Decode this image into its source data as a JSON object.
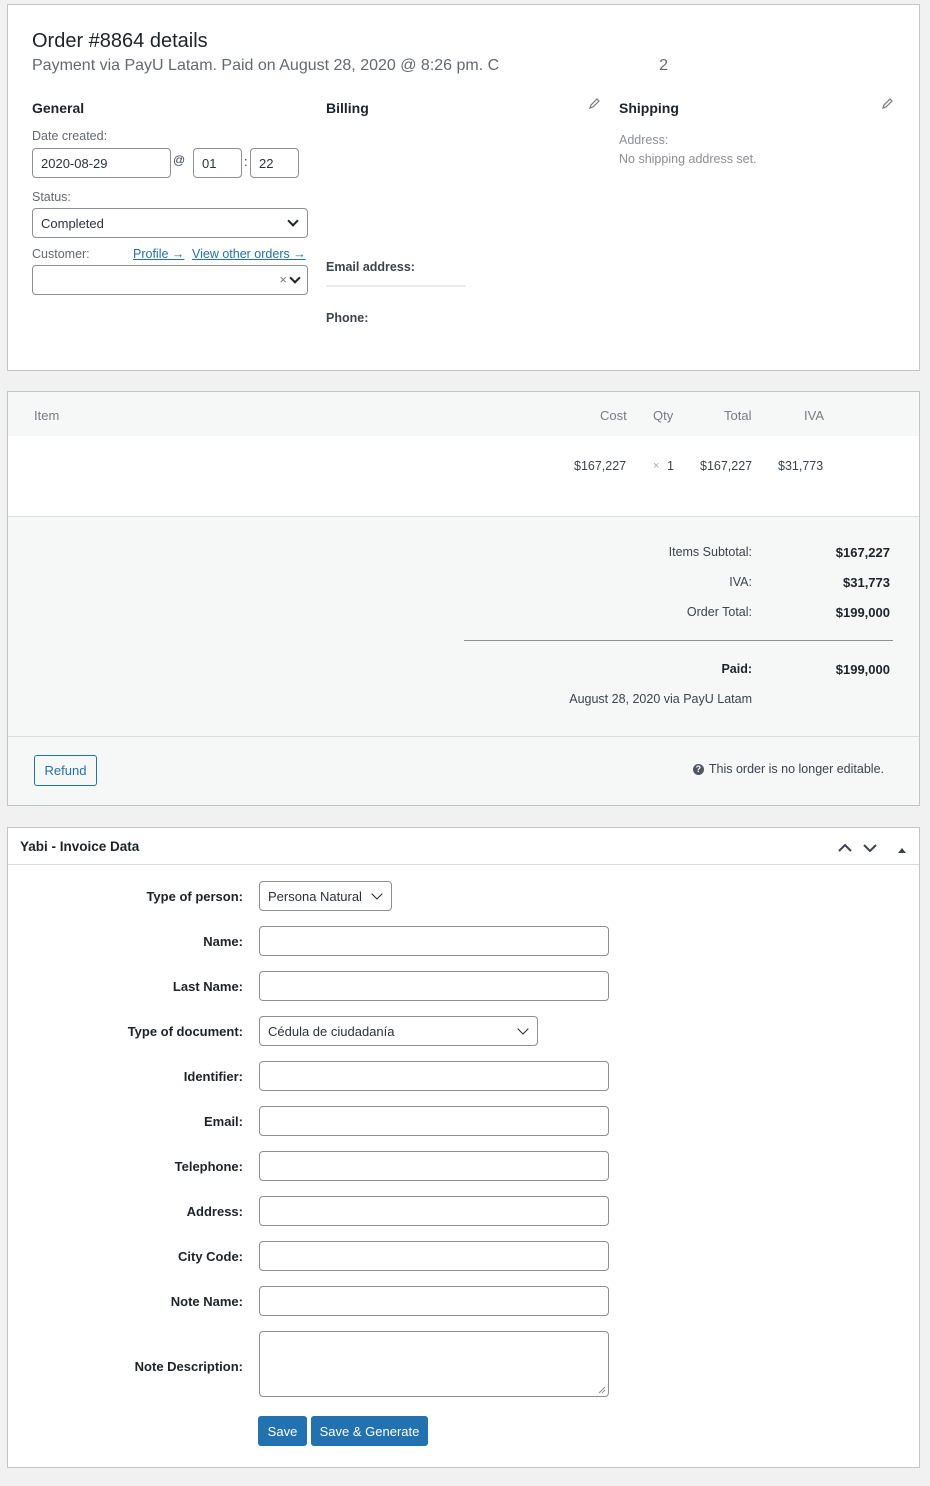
{
  "order": {
    "title": "Order #8864 details",
    "subtitle": "Payment via PayU Latam. Paid on August 28, 2020 @ 8:26 pm. C",
    "subtitle_tail": "2",
    "general": {
      "heading": "General",
      "date_label": "Date created:",
      "date_value": "2020-08-29",
      "at": "@",
      "hour": "01",
      "colon": ":",
      "minute": "22",
      "status_label": "Status:",
      "status_value": "Completed",
      "customer_label": "Customer:",
      "profile_link": "Profile →",
      "other_orders_link": "View other orders →",
      "clear_x": "×"
    },
    "billing": {
      "heading": "Billing",
      "email_label": "Email address:",
      "phone_label": "Phone:"
    },
    "shipping": {
      "heading": "Shipping",
      "address_label": "Address:",
      "address_value": "No shipping address set."
    }
  },
  "items": {
    "headers": {
      "item": "Item",
      "cost": "Cost",
      "qty": "Qty",
      "total": "Total",
      "tax": "IVA"
    },
    "row": {
      "cost": "$167,227",
      "qty_x": "×",
      "qty": "1",
      "total": "$167,227",
      "tax": "$31,773"
    },
    "totals": {
      "subtotal_label": "Items Subtotal:",
      "subtotal_value": "$167,227",
      "tax_label": "IVA:",
      "tax_value": "$31,773",
      "order_total_label": "Order Total:",
      "order_total_value": "$199,000",
      "paid_label": "Paid:",
      "paid_value": "$199,000",
      "paid_note": "August 28, 2020 via PayU Latam"
    },
    "refund_button": "Refund",
    "not_editable": "This order is no longer editable."
  },
  "invoice": {
    "title": "Yabi - Invoice Data",
    "fields": {
      "person_type_label": "Type of person:",
      "person_type_value": "Persona Natural",
      "name_label": "Name:",
      "last_name_label": "Last Name:",
      "doc_type_label": "Type of document:",
      "doc_type_value": "Cédula de ciudadanía",
      "identifier_label": "Identifier:",
      "email_label": "Email:",
      "telephone_label": "Telephone:",
      "address_label": "Address:",
      "city_code_label": "City Code:",
      "note_name_label": "Note Name:",
      "note_desc_label": "Note Description:"
    },
    "save_button": "Save",
    "save_generate_button": "Save & Generate"
  },
  "icons": {
    "edit": "pencil-icon",
    "help": "question-circle-icon",
    "collapse_up": "chevron-up-icon",
    "collapse_down": "chevron-down-icon",
    "toggle": "triangle-up-icon"
  }
}
